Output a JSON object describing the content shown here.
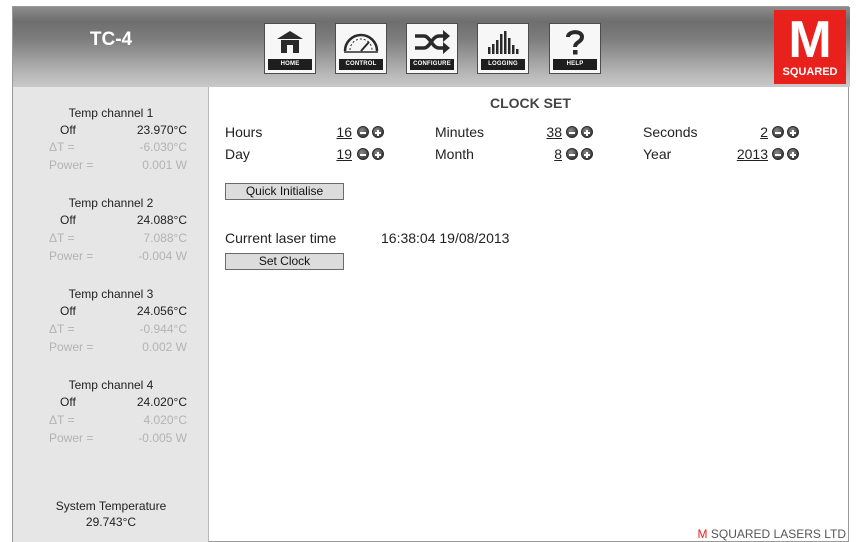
{
  "header": {
    "title": "TC-4",
    "nav": [
      {
        "label": "HOME",
        "icon": "home-icon"
      },
      {
        "label": "CONTROL",
        "icon": "gauge-icon"
      },
      {
        "label": "CONFIGURE",
        "icon": "shuffle-icon"
      },
      {
        "label": "LOGGING",
        "icon": "bar-graph-icon"
      },
      {
        "label": "HELP",
        "icon": "question-icon"
      }
    ],
    "brand_big": "M",
    "brand_small": "SQUARED",
    "brand_color": "#e8211c"
  },
  "sidebar": {
    "channels": [
      {
        "title": "Temp channel 1",
        "state": "Off",
        "temp": "23.970°C",
        "dt_label": "ΔT =",
        "dt": "-6.030°C",
        "power_label": "Power =",
        "power": "0.001 W"
      },
      {
        "title": "Temp channel 2",
        "state": "Off",
        "temp": "24.088°C",
        "dt_label": "ΔT =",
        "dt": "7.088°C",
        "power_label": "Power =",
        "power": "-0.004 W"
      },
      {
        "title": "Temp channel 3",
        "state": "Off",
        "temp": "24.056°C",
        "dt_label": "ΔT =",
        "dt": "-0.944°C",
        "power_label": "Power =",
        "power": "0.002 W"
      },
      {
        "title": "Temp channel 4",
        "state": "Off",
        "temp": "24.020°C",
        "dt_label": "ΔT =",
        "dt": "4.020°C",
        "power_label": "Power =",
        "power": "-0.005 W"
      }
    ],
    "system_title": "System Temperature",
    "system_value": "29.743°C"
  },
  "main": {
    "heading": "CLOCK SET",
    "fields": {
      "hours": {
        "label": "Hours",
        "value": "16"
      },
      "minutes": {
        "label": "Minutes",
        "value": "38"
      },
      "seconds": {
        "label": "Seconds",
        "value": "2"
      },
      "day": {
        "label": "Day",
        "value": "19"
      },
      "month": {
        "label": "Month",
        "value": "8"
      },
      "year": {
        "label": "Year",
        "value": "2013"
      }
    },
    "quick_init_label": "Quick Initialise",
    "current_time_label": "Current laser time",
    "current_time_value": "16:38:04 19/08/2013",
    "set_clock_label": "Set Clock"
  },
  "footer": {
    "m": "M",
    "text": " SQUARED LASERS LTD"
  }
}
